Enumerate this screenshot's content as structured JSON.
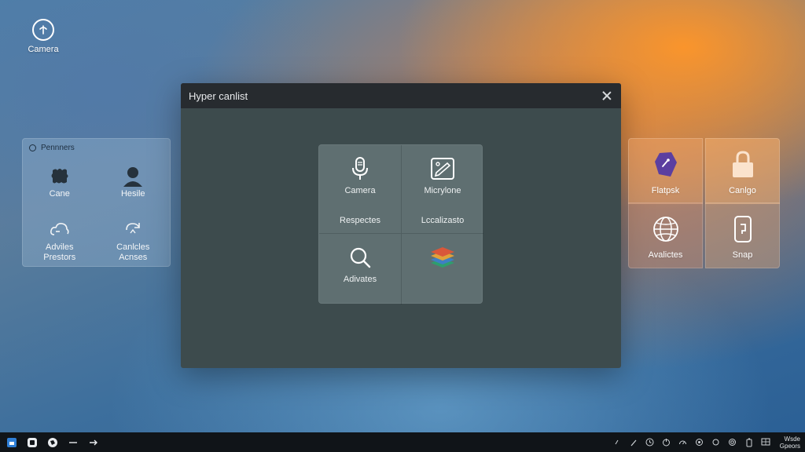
{
  "desktop": {
    "camera_icon_label": "Camera"
  },
  "left_panel": {
    "header": "Pennners",
    "items": [
      {
        "label": "Cane",
        "icon": "puzzle-icon"
      },
      {
        "label": "Hesile",
        "icon": "user-icon"
      },
      {
        "label": "Adviles\nPrestors",
        "icon": "cloud-icon"
      },
      {
        "label": "Canlcles\nAcnses",
        "icon": "sync-icon"
      }
    ]
  },
  "window": {
    "title": "Hyper canlist",
    "grid": {
      "camera_label": "Camera",
      "microphone_label": "Micrylone",
      "respectes_label": "Respectes",
      "localizasto_label": "Lccalizasto",
      "activates_label": "Adivates"
    }
  },
  "right_tiles": [
    {
      "label": "Flatpsk",
      "icon": "flatpak-icon",
      "bg": "rgba(235,160,100,0.55)"
    },
    {
      "label": "Canlgo",
      "icon": "lock-icon",
      "bg": "rgba(245,175,110,0.55)"
    },
    {
      "label": "Avalictes",
      "icon": "globe-icon",
      "bg": "rgba(200,140,110,0.45)"
    },
    {
      "label": "Snap",
      "icon": "phone-icon",
      "bg": "rgba(210,160,120,0.45)"
    }
  ],
  "taskbar": {
    "clock_line1": "Wsde",
    "clock_line2": "Gpeors"
  },
  "colors": {
    "window_bg": "#3d4b4d",
    "titlebar_bg": "#272b2f",
    "app_grid_bg": "#5f6f71",
    "taskbar_bg": "#101418"
  }
}
